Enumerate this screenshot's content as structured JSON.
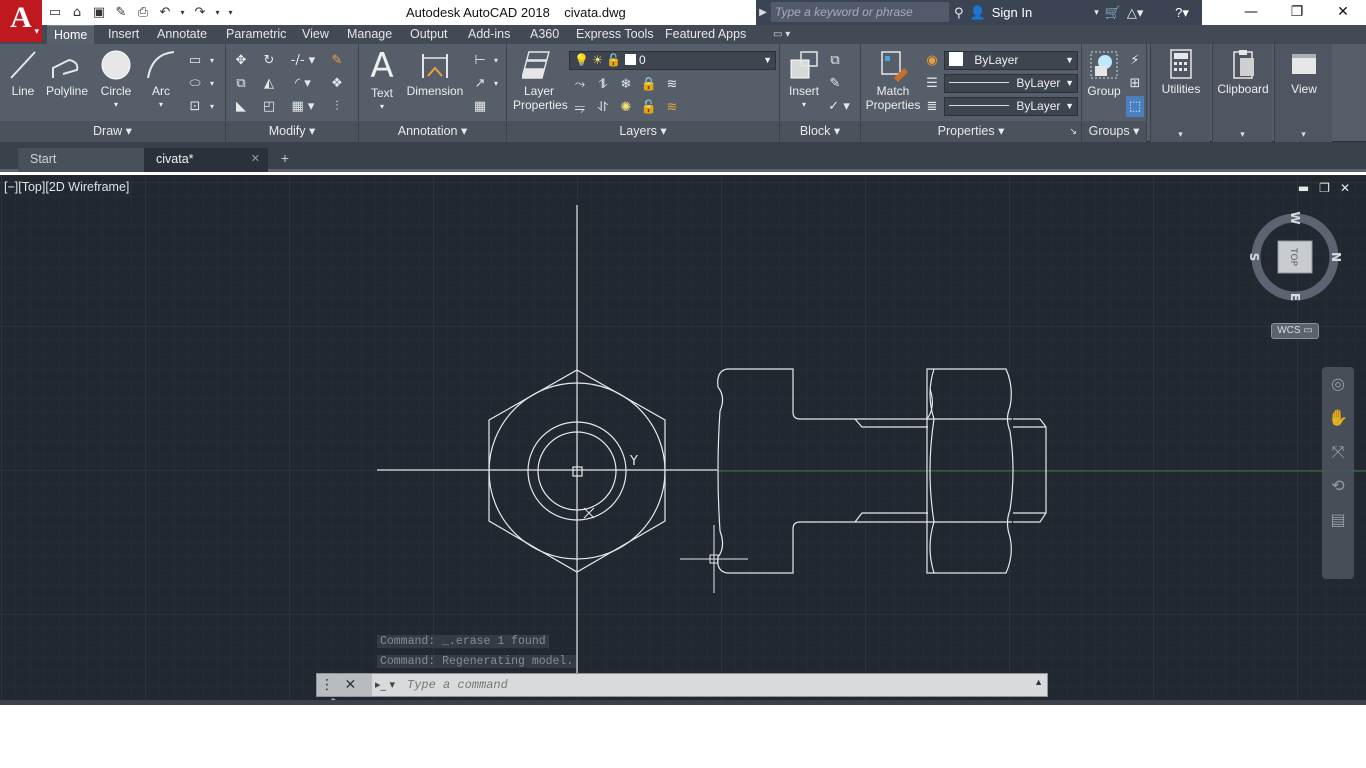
{
  "title": "Autodesk AutoCAD 2018    civata.dwg",
  "app_button": {
    "letter": "A",
    "caret": "▾"
  },
  "qat": [
    "▭",
    "⌂",
    "▣",
    "✎",
    "⎙",
    "↶",
    "▾",
    "↷",
    "▾",
    "▾"
  ],
  "search": {
    "placeholder": "Type a keyword or phrase",
    "signin": "Sign In"
  },
  "window_controls": {
    "min": "—",
    "max": "❐",
    "close": "✕"
  },
  "ribbon_tabs": [
    "Home",
    "Insert",
    "Annotate",
    "Parametric",
    "View",
    "Manage",
    "Output",
    "Add-ins",
    "A360",
    "Express Tools",
    "Featured Apps"
  ],
  "ribbon": {
    "draw": {
      "label": "Draw",
      "tools": {
        "line": "Line",
        "polyline": "Polyline",
        "circle": "Circle",
        "arc": "Arc"
      }
    },
    "modify": {
      "label": "Modify"
    },
    "annotation": {
      "label": "Annotation",
      "text": "Text",
      "dimension": "Dimension"
    },
    "layers": {
      "label": "Layers",
      "layer_properties": [
        "Layer",
        "Properties"
      ],
      "current_layer": "0"
    },
    "block": {
      "label": "Block",
      "insert": "Insert"
    },
    "properties": {
      "label": "Properties",
      "match": [
        "Match",
        "Properties"
      ],
      "color": "ByLayer",
      "linetype": "ByLayer",
      "lineweight": "ByLayer"
    },
    "groups": {
      "label": "Groups",
      "group": "Group"
    },
    "utilities": {
      "label": "Utilities"
    },
    "clipboard": {
      "label": "Clipboard"
    },
    "view": {
      "label": "View"
    }
  },
  "file_tabs": {
    "start": "Start",
    "current": "civata*",
    "close": "✕",
    "new": "+"
  },
  "viewport": {
    "label": "[−][Top][2D Wireframe]",
    "ctrls": [
      "▬",
      "❐",
      "✕"
    ]
  },
  "viewcube": {
    "top": "TOP",
    "n": "N",
    "s": "S",
    "e": "E",
    "w": "W",
    "wcs": "WCS ▭"
  },
  "ucs": {
    "y": "Y",
    "x": "X"
  },
  "command": {
    "history": [
      "Command:  _.erase 1 found",
      "Command:  Regenerating model."
    ],
    "placeholder": "Type a command",
    "grip": "⋮ ✕  🔧",
    "prompt": "▸_ ▾",
    "up": "▲"
  },
  "colors": {
    "canvas": "#212830",
    "ribbon": "#565e69",
    "accent": "#c0181f"
  }
}
